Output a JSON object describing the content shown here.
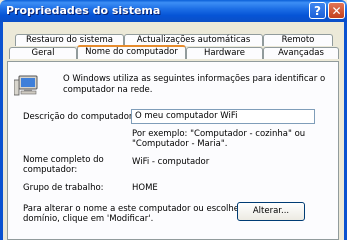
{
  "window": {
    "title": "Propriedades do sistema"
  },
  "title_buttons": {
    "help": "?",
    "close": "✕"
  },
  "tabs_row1": [
    "Restauro do sistema",
    "Actualizações automáticas",
    "Remoto"
  ],
  "tabs_row2": [
    "Geral",
    "Nome do computador",
    "Hardware",
    "Avançadas"
  ],
  "active_tab": "Nome do computador",
  "panel": {
    "intro_line1": "O Windows utiliza as seguintes informações para identificar o",
    "intro_line2": "computador na rede.",
    "description_label": "Descrição do computador:",
    "description_value": "O meu computador WiFi",
    "example_line1": "Por exemplo: \"Computador - cozinha\" ou",
    "example_line2": "\"Computador - Maria\".",
    "fullname_label_line1": "Nome completo do",
    "fullname_label_line2": "computador:",
    "fullname_value": "WiFi - computador",
    "workgroup_label": "Grupo de trabalho:",
    "workgroup_value": "HOME",
    "rename_line1": "Para alterar o nome a este computador ou escolher um",
    "rename_line2": "domínio, clique em 'Modificar'.",
    "change_button": "Alterar..."
  }
}
